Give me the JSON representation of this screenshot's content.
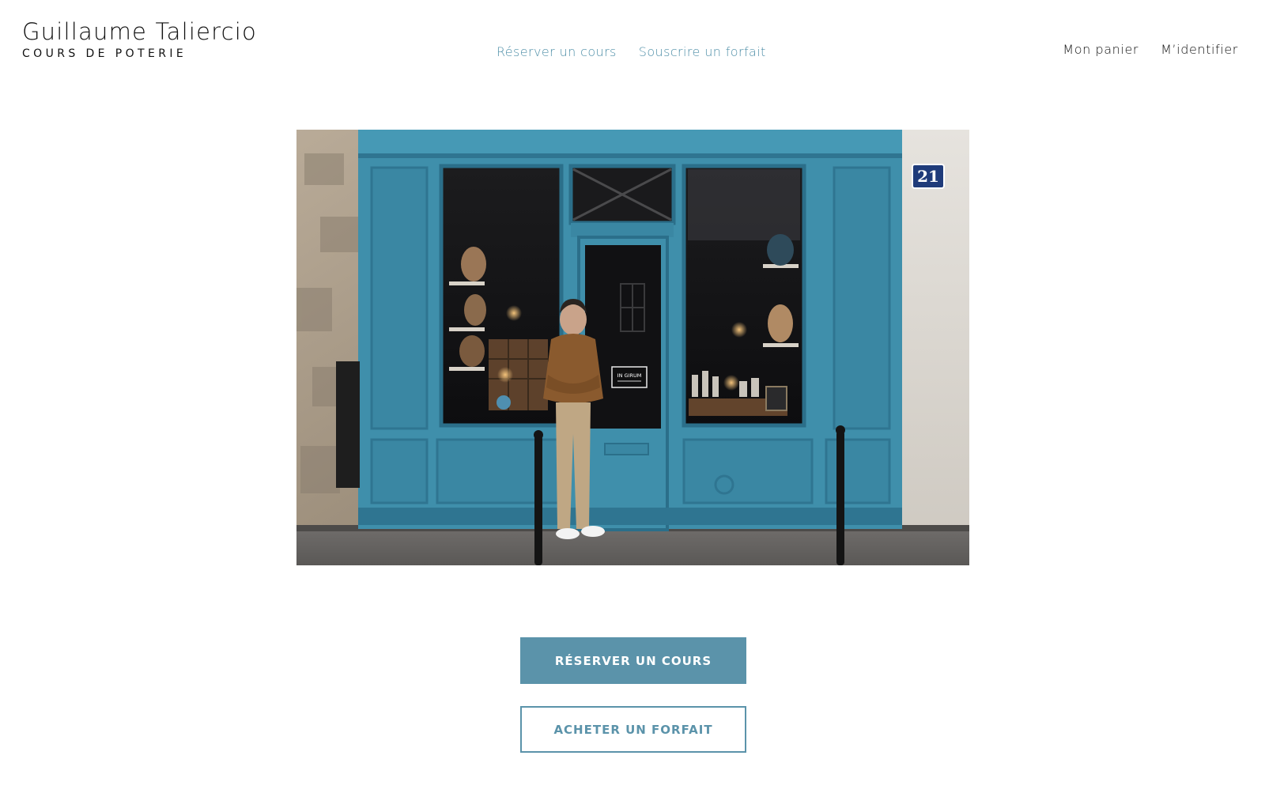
{
  "brand": {
    "title": "Guillaume Taliercio",
    "subtitle": "COURS DE POTERIE"
  },
  "main_nav": [
    {
      "label": "Réserver un cours"
    },
    {
      "label": "Souscrire un forfait"
    }
  ],
  "account_nav": [
    {
      "label": "Mon panier"
    },
    {
      "label": "M’identifier"
    }
  ],
  "hero": {
    "street_number": "21",
    "door_sign": "IN GIRUM"
  },
  "cta": {
    "primary_label": "RÉSERVER UN COURS",
    "secondary_label": "ACHETER UN FORFAIT"
  },
  "colors": {
    "accent": "#5b93aa",
    "shopfront_blue": "#3f8fab",
    "text": "#111111"
  }
}
